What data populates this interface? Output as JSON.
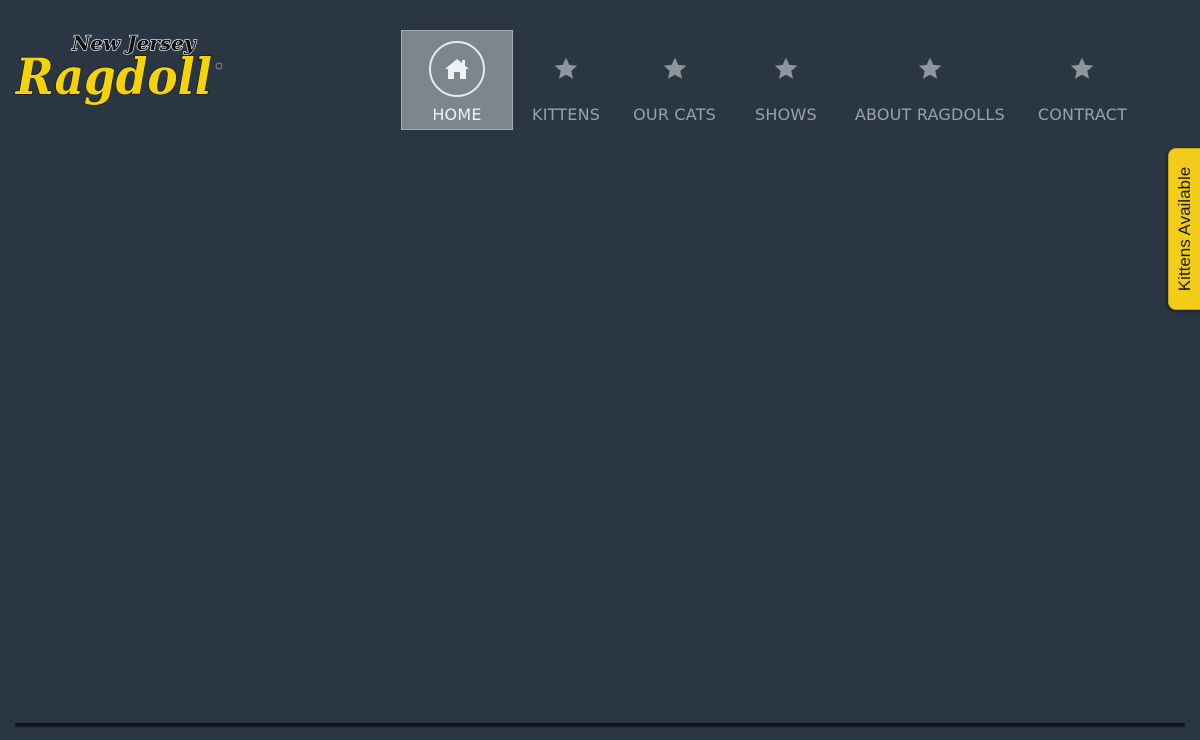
{
  "logo": {
    "line1": "New Jersey",
    "line2": "Ragdoll",
    "accent_color": "#f5d30c"
  },
  "nav": {
    "items": [
      {
        "label": "HOME",
        "icon": "home-icon",
        "active": true
      },
      {
        "label": "KITTENS",
        "icon": "star-icon",
        "active": false
      },
      {
        "label": "OUR CATS",
        "icon": "star-icon",
        "active": false
      },
      {
        "label": "SHOWS",
        "icon": "star-icon",
        "active": false
      },
      {
        "label": "ABOUT RAGDOLLS",
        "icon": "star-icon",
        "active": false
      },
      {
        "label": "CONTRACT",
        "icon": "star-icon",
        "active": false
      }
    ]
  },
  "side_tab": {
    "label": "Kittens Available",
    "color": "#f2cc19"
  },
  "colors": {
    "background": "#2a3642",
    "nav_text": "#99a1a9",
    "nav_active_bg": "#7d858d"
  }
}
